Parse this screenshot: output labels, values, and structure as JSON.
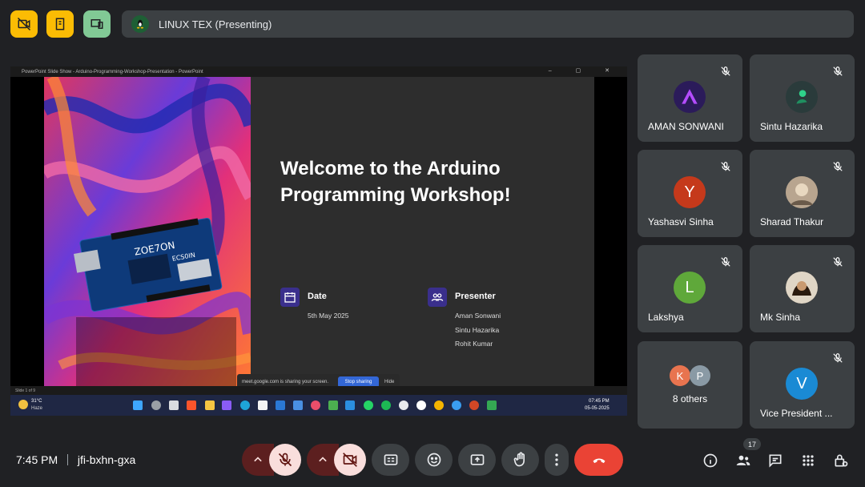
{
  "presenting_bar": {
    "title": "LINUX TEX (Presenting)"
  },
  "shared_window": {
    "title": "PowerPoint Slide Show  -  Arduino-Programming-Workshop-Presentation - PowerPoint",
    "window_controls": "– ▢ ✕",
    "slide": {
      "heading_line1": "Welcome to the Arduino",
      "heading_line2": "Programming Workshop!",
      "date_label": "Date",
      "date_value": "5th May 2025",
      "presenter_label": "Presenter",
      "presenters": [
        "Aman Sonwani",
        "Sintu Hazarika",
        "Rohit Kumar"
      ],
      "board_text_1": "ZOE7ON",
      "board_text_2": "ECS0IN"
    },
    "share_notice": {
      "message": "meet.google.com is sharing your screen.",
      "stop_label": "Stop sharing",
      "hide_label": "Hide"
    },
    "status_bar": {
      "slide_counter": "Slide 1 of 9"
    },
    "taskbar": {
      "weather_temp": "31°C",
      "weather_desc": "Haze",
      "time": "07:45 PM",
      "date": "05-05-2025"
    }
  },
  "participants": [
    {
      "name": "AMAN SONWANI",
      "initial": "",
      "color": "#2b1b5a"
    },
    {
      "name": "Sintu Hazarika",
      "initial": "",
      "color": "#2a3b3b"
    },
    {
      "name": "Yashasvi Sinha",
      "initial": "Y",
      "color": "#c5391b"
    },
    {
      "name": "Sharad Thakur",
      "initial": "",
      "color": "#8a7a6a"
    },
    {
      "name": "Lakshya",
      "initial": "L",
      "color": "#5fa83a"
    },
    {
      "name": "Mk Sinha",
      "initial": "",
      "color": "#3a2a1a"
    },
    {
      "name": "8 others",
      "initial_a": "K",
      "initial_b": "P",
      "color_a": "#e8744f",
      "color_b": "#8a9aa5"
    },
    {
      "name": "Vice President ...",
      "initial": "V",
      "color": "#1a8ad4"
    }
  ],
  "bottom_bar": {
    "time": "7:45 PM",
    "meeting_code": "jfi-bxhn-gxa",
    "participant_count": "17"
  },
  "colors": {
    "background": "#202124",
    "tile": "#3c4043",
    "muted_control": "#f9dedc",
    "hangup": "#ea4335",
    "top_yellow": "#fbbc04",
    "top_green": "#81c995"
  }
}
